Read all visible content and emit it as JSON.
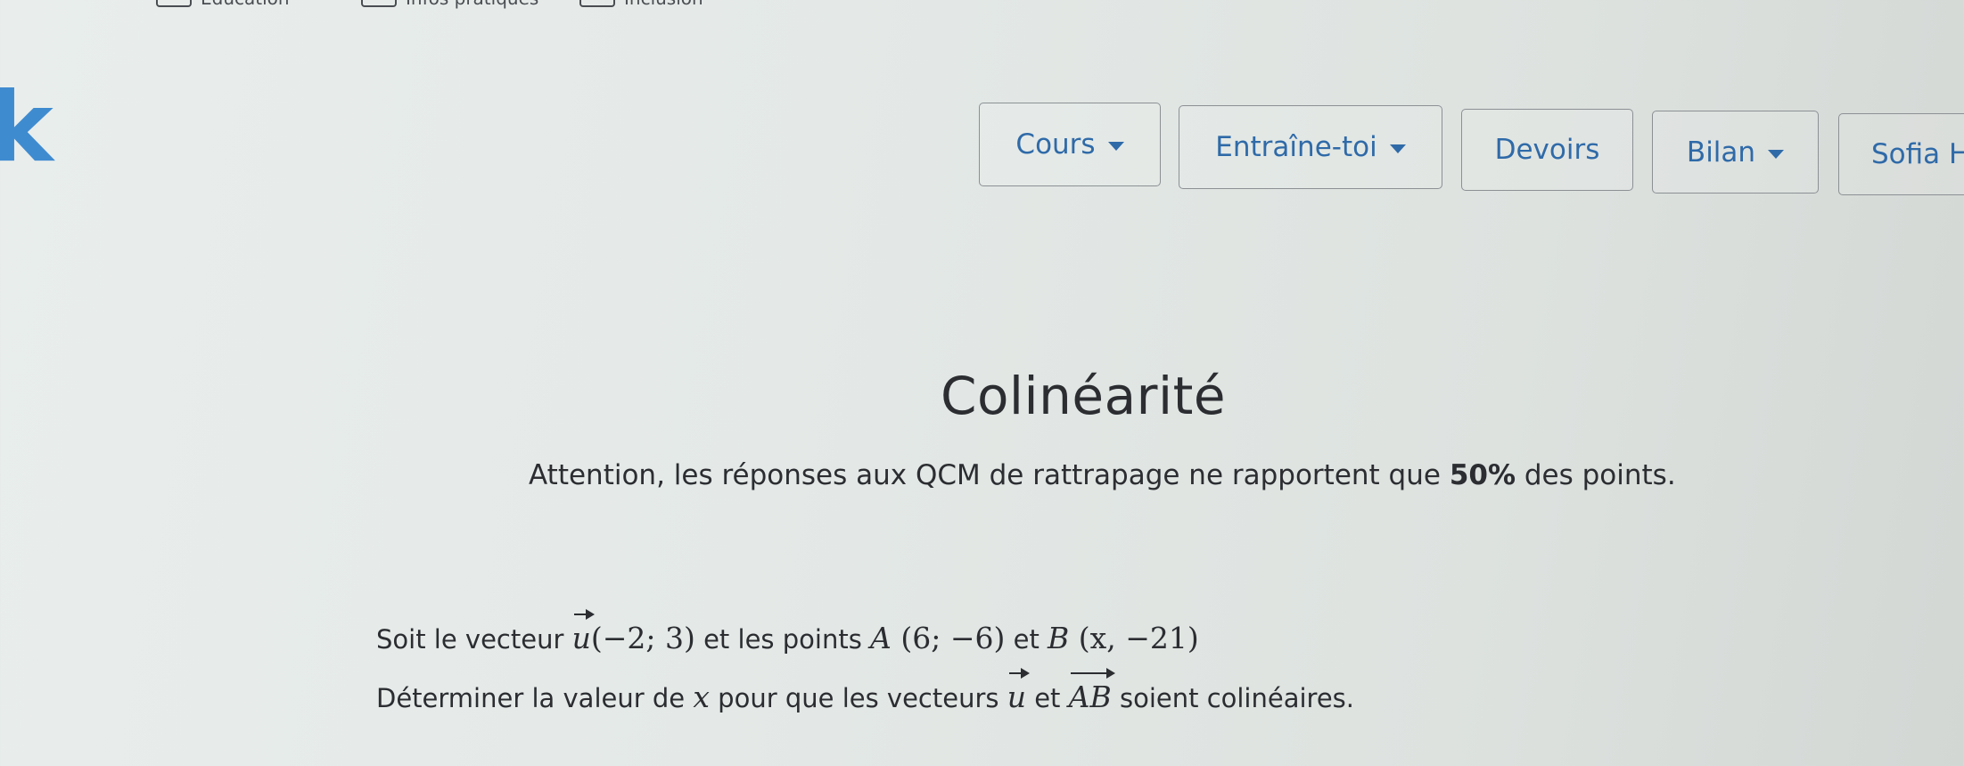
{
  "filters": [
    {
      "label": "Éducation"
    },
    {
      "label": "Infos pratiques"
    },
    {
      "label": "Inclusion"
    }
  ],
  "logo": {
    "text": "k"
  },
  "nav": {
    "cours": "Cours",
    "entraine": "Entraîne-toi",
    "devoirs": "Devoirs",
    "bilan": "Bilan",
    "user": "Sofia H"
  },
  "content": {
    "title": "Colinéarité",
    "notice_before": "Attention, les réponses aux QCM de rattrapage ne rapportent que ",
    "notice_bold": "50%",
    "notice_after": " des points.",
    "q1_intro": "Soit le vecteur ",
    "q1_vec": "u",
    "q1_vec_coords": "(−2; 3)",
    "q1_mid": " et les points ",
    "point_a_name": "A",
    "point_a_coords": " (6; −6)",
    "q1_and": " et ",
    "point_b_name": "B",
    "point_b_coords": " (x, −21)",
    "q2_intro": "Déterminer la valeur de ",
    "q2_var": "x",
    "q2_mid": " pour que les vecteurs ",
    "q2_vec_u": "u",
    "q2_and": " et ",
    "q2_vec_ab": "AB",
    "q2_end": " soient colinéaires."
  },
  "colors": {
    "accent": "#2f6aa8",
    "logo": "#3f8bd0",
    "text": "#2b2d31"
  }
}
